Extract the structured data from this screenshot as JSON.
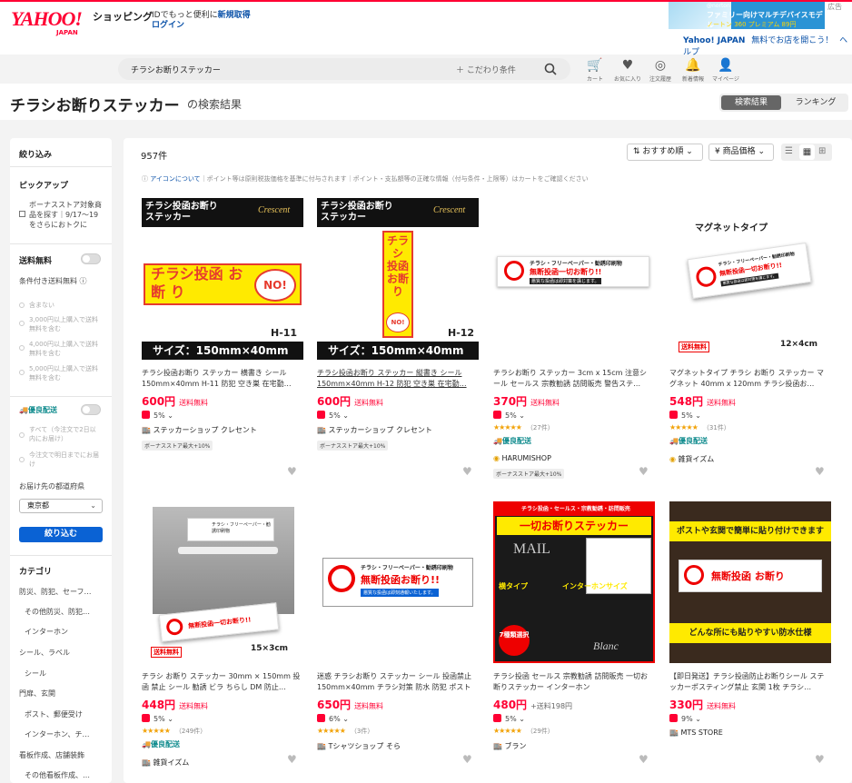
{
  "header": {
    "logo": "YAHOO!",
    "logo_sub": "JAPAN",
    "shop": "ショッピング",
    "id_text": "IDでもっと便利に",
    "id_link": "新規取得",
    "login": "ログイン",
    "ad": {
      "label": "広告",
      "l1": "@norton",
      "l2": "ファミリー向けマルチデバイスモデル",
      "l3": "ノートン 360 プレミアム 89円"
    },
    "links": [
      "Yahoo! JAPAN",
      "無料でお店を開こう！",
      "ヘルプ"
    ],
    "search_value": "チラシお断りステッカー",
    "kodawari": "こだわり条件",
    "icons": [
      {
        "label": "カート",
        "icon": "cart-icon"
      },
      {
        "label": "お気に入り",
        "icon": "heart-icon"
      },
      {
        "label": "注文履歴",
        "icon": "history-icon"
      },
      {
        "label": "新着情報",
        "icon": "bell-icon"
      },
      {
        "label": "マイページ",
        "icon": "user-icon"
      }
    ]
  },
  "title": {
    "main": "チラシお断りステッカー",
    "sub": "の検索結果",
    "tabs": [
      "検索結果",
      "ランキング"
    ]
  },
  "sidebar": {
    "narrow": "絞り込み",
    "pickup": "ピックアップ",
    "bonus": "ボーナスストア対象商品を探す｜9/17〜19をさらにおトクに",
    "free_ship": "送料無料",
    "cond_free": "条件付き送料無料",
    "free_opts": [
      "含まない",
      "3,000円以上購入で送料無料を含む",
      "4,000円以上購入で送料無料を含む",
      "5,000円以上購入で送料無料を含む"
    ],
    "yuusen": "優良配送",
    "yuusen_opts": [
      "すべて（今注文で2日以内にお届け）",
      "今注文で明日までにお届け"
    ],
    "pref_label": "お届け先の都道府県",
    "pref": "東京都",
    "narrow_btn": "絞り込む",
    "category": "カテゴリ",
    "cats": [
      "防災、防犯、セーフ…",
      "その他防災、防犯…",
      "インターホン",
      "シール、ラベル",
      "シール",
      "門扉、玄関",
      "ポスト、郵便受け",
      "インターホン、チ…",
      "看板作成、店舗装飾",
      "その他看板作成、…"
    ]
  },
  "results": {
    "count": "957件",
    "sort": "おすすめ順",
    "price_sort": "¥ 商品価格",
    "notice_link": "アイコンについて",
    "notice": "｜ポイント等は原則税抜価格を基準に付与されます｜ポイント・支払額等の正確な情報（付与条件・上限等）はカートをご確認ください",
    "items": [
      {
        "name": "チラシ投函お断り ステッカー 横書き シール 150mm×40mm H-11 防犯 空き巣 在宅勤…",
        "price": "600円",
        "ship": "送料無料",
        "pt": "5%",
        "store": "ステッカーショップ クレセント",
        "badge": "ボーナスストア最大+10%",
        "img": {
          "head": "チラシ投函お断り ステッカー",
          "brand": "Crescent",
          "main": "チラシ投函 お 断 り",
          "no": "NO!",
          "code": "H-11",
          "size": "サイズ：150mm×40mm"
        }
      },
      {
        "name": "チラシ投函お断り ステッカー 縦書き シール 150mm×40mm H-12 防犯 空き巣 在宅勤…",
        "price": "600円",
        "ship": "送料無料",
        "pt": "5%",
        "store": "ステッカーショップ クレセント",
        "badge": "ボーナスストア最大+10%",
        "img": {
          "head": "チラシ投函お断り ステッカー",
          "brand": "Crescent",
          "main": "チラシ 投函 お断り",
          "no": "NO!",
          "code": "H-12",
          "size": "サイズ：150mm×40mm"
        }
      },
      {
        "name": "チラシお断り ステッカー 3cm x 15cm 注意シール セールス 宗教勧誘 訪問販売 警告ステ…",
        "price": "370円",
        "ship": "送料無料",
        "pt": "5%",
        "rating": "★★★★★",
        "reviews": "（27件）",
        "yuusen": "優良配送",
        "store": "HARUMISHOP",
        "badge": "ボーナスストア最大+10%",
        "img": {
          "top": "チラシ・フリーペーパー・勧誘印刷物",
          "main": "無断投函一切お断り!!",
          "sub": "悪質な投函は即対策を講じます。"
        }
      },
      {
        "name": "マグネットタイプ チラシ お断り ステッカー マグネット 40mm x 120mm チラシ投函お…",
        "price": "548円",
        "ship": "送料無料",
        "pt": "5%",
        "rating": "★★★★★",
        "reviews": "（31件）",
        "yuusen": "優良配送",
        "store": "雑貨イズム",
        "img": {
          "head": "マグネットタイプ",
          "top": "チラシ・フリーペーパー・勧誘印刷物",
          "main": "無断投函一切お断り!!",
          "sub": "悪質な投函は即対策を講じます。",
          "tag": "送料無料",
          "size": "12×4cm"
        }
      },
      {
        "name": "チラシ お断り ステッカー 30mm × 150mm 投函 禁止 シール 勧誘 ビラ ちらし DM 防止…",
        "price": "448円",
        "ship": "送料無料",
        "pt": "5%",
        "rating": "★★★★★",
        "reviews": "（249件）",
        "yuusen": "優良配送",
        "store": "雑貨イズム",
        "img": {
          "top": "チラシ・フリーペーパー・勧誘印刷物",
          "main": "無断投函一切お断り!!",
          "tag": "送料無料",
          "size": "15×3cm"
        }
      },
      {
        "name": "迷惑 チラシお断り ステッカー シール 投函禁止 150mm×40mm チラシ対策 防水 防犯 ポスト",
        "price": "650円",
        "ship": "送料無料",
        "pt": "6%",
        "rating": "★★★★★",
        "reviews": "（3件）",
        "store": "Tシャツショップ そら",
        "img": {
          "top": "チラシ・フリーペーパー・勧誘印刷物",
          "main": "無断投函お断り!!",
          "sub": "悪質な投函は即刻通報いたします。"
        }
      },
      {
        "name": "チラシ投函 セールス 宗教勧誘 訪問販売 一切お断りステッカー インターホン",
        "price": "480円",
        "ship": "+送料198円",
        "pt": "5%",
        "rating": "★★★★★",
        "reviews": "（29件）",
        "store": "ブラン",
        "img": {
          "head": "チラシ投函・セールス・宗教勧誘・訪問販売",
          "title": "一切お断りステッカー",
          "mail": "MAIL",
          "left": "横タイプ",
          "right": "インターホンサイズ",
          "num": "7種類選択",
          "brand": "Blanc"
        }
      },
      {
        "name": "【即日発送】チラシ投函防止お断りシール ステッカーポスティング禁止 玄関 1枚 チラシ…",
        "price": "330円",
        "ship": "送料無料",
        "pt": "9%",
        "store": "MTS STORE",
        "img": {
          "top": "ポストや玄関で簡単に貼り付けできます",
          "main": "無断投函 お断り",
          "bottom": "どんな所にも貼りやすい防水仕様"
        }
      }
    ]
  },
  "colors": {
    "accent": "#ff0033",
    "link": "#0a51a8",
    "button": "#0a62d4",
    "yuusen": "#0f8b8d"
  }
}
